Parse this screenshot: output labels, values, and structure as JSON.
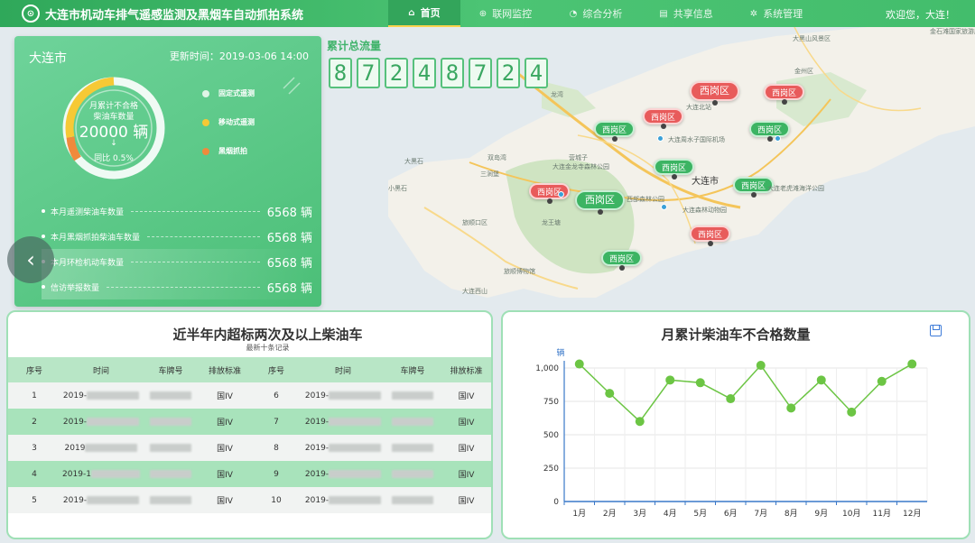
{
  "header": {
    "app_title": "大连市机动车排气遥感监测及黑烟车自动抓拍系统",
    "nav": [
      {
        "label": "首页",
        "icon": "home-icon",
        "glyph": "⌂",
        "active": true
      },
      {
        "label": "联网监控",
        "icon": "globe-icon",
        "glyph": "⊕",
        "active": false
      },
      {
        "label": "综合分析",
        "icon": "pie-icon",
        "glyph": "◔",
        "active": false
      },
      {
        "label": "共享信息",
        "icon": "document-icon",
        "glyph": "▤",
        "active": false
      },
      {
        "label": "系统管理",
        "icon": "gear-icon",
        "glyph": "✲",
        "active": false
      }
    ],
    "welcome": "欢迎您，大连！"
  },
  "total": {
    "title": "累计总流量",
    "digits": [
      "8",
      "7",
      "2",
      "4",
      "8",
      "7",
      "2",
      "4"
    ]
  },
  "left_panel": {
    "city": "大连市",
    "update_label": "更新时间：2019-03-06  14:00",
    "gauge": {
      "line1": "月累计不合格",
      "line2": "柴油车数量",
      "value": "20000 辆",
      "arrow": "↓",
      "compare": "同比 0.5%"
    },
    "legend": [
      {
        "label": "固定式遥测",
        "color": "#dff5e6"
      },
      {
        "label": "移动式遥测",
        "color": "#f6c935"
      },
      {
        "label": "黑烟抓拍",
        "color": "#f08a3c"
      }
    ],
    "stats": [
      {
        "label": "本月遥测柴油车数量",
        "value": "6568 辆"
      },
      {
        "label": "本月黑烟抓拍柴油车数量",
        "value": "6568 辆"
      },
      {
        "label": "本月环检机动车数量",
        "value": "6568 辆"
      },
      {
        "label": "信访举报数量",
        "value": "6568 辆"
      }
    ]
  },
  "map": {
    "badges": [
      {
        "label": "西岗区",
        "color": "red",
        "big": true
      },
      {
        "label": "西岗区",
        "color": "red",
        "big": false
      },
      {
        "label": "西岗区",
        "color": "red",
        "big": false
      },
      {
        "label": "西岗区",
        "color": "green",
        "big": false
      },
      {
        "label": "西岗区",
        "color": "green",
        "big": false
      },
      {
        "label": "西岗区",
        "color": "green",
        "big": false
      },
      {
        "label": "西岗区",
        "color": "red",
        "big": false
      },
      {
        "label": "西岗区",
        "color": "green",
        "big": true
      },
      {
        "label": "西岗区",
        "color": "green",
        "big": false
      },
      {
        "label": "西岗区",
        "color": "red",
        "big": false
      },
      {
        "label": "西岗区",
        "color": "green",
        "big": false
      }
    ],
    "labels": [
      "大黑山风景区",
      "金州区",
      "大连北站",
      "大连周水子国际机场",
      "大连市",
      "旅顺口区",
      "大连金龙寺森林公园",
      "大连森林动物园",
      "金石滩国家旅游度假区",
      "西部森林公园",
      "大连西山",
      "龙王塘",
      "旅顺博物馆",
      "双岛湾",
      "三涧堡",
      "营城子",
      "大连老虎滩海洋公园",
      "大黑石",
      "龙湾",
      "小黑石"
    ]
  },
  "table": {
    "title": "近半年内超标两次及以上柴油车",
    "subtitle": "最新十条记录",
    "headers": [
      "序号",
      "时间",
      "车牌号",
      "排放标准",
      "序号",
      "时间",
      "车牌号",
      "排放标准"
    ],
    "rows": [
      {
        "no1": "1",
        "time1": "2019-",
        "std1": "国IV",
        "no2": "6",
        "time2": "2019-",
        "std2": "国IV"
      },
      {
        "no1": "2",
        "time1": "2019-",
        "std1": "国IV",
        "no2": "7",
        "time2": "2019-",
        "std2": "国IV"
      },
      {
        "no1": "3",
        "time1": "2019",
        "std1": "国IV",
        "no2": "8",
        "time2": "2019-",
        "std2": "国IV"
      },
      {
        "no1": "4",
        "time1": "2019-1",
        "std1": "国IV",
        "no2": "9",
        "time2": "2019-",
        "std2": "国IV"
      },
      {
        "no1": "5",
        "time1": "2019-",
        "std1": "国IV",
        "no2": "10",
        "time2": "2019-",
        "std2": "国IV"
      }
    ]
  },
  "chart_data": {
    "type": "line",
    "title": "月累计柴油车不合格数量",
    "ylabel": "辆",
    "xlabel": "",
    "categories": [
      "1月",
      "2月",
      "3月",
      "4月",
      "5月",
      "6月",
      "7月",
      "8月",
      "9月",
      "10月",
      "11月",
      "12月"
    ],
    "values": [
      1030,
      810,
      600,
      910,
      890,
      770,
      1020,
      700,
      910,
      670,
      900,
      1030
    ],
    "ylim": [
      0,
      1000
    ],
    "yticks": [
      "0",
      "250",
      "500",
      "750",
      "1,000"
    ],
    "grid": true,
    "color": "#6cc544"
  }
}
